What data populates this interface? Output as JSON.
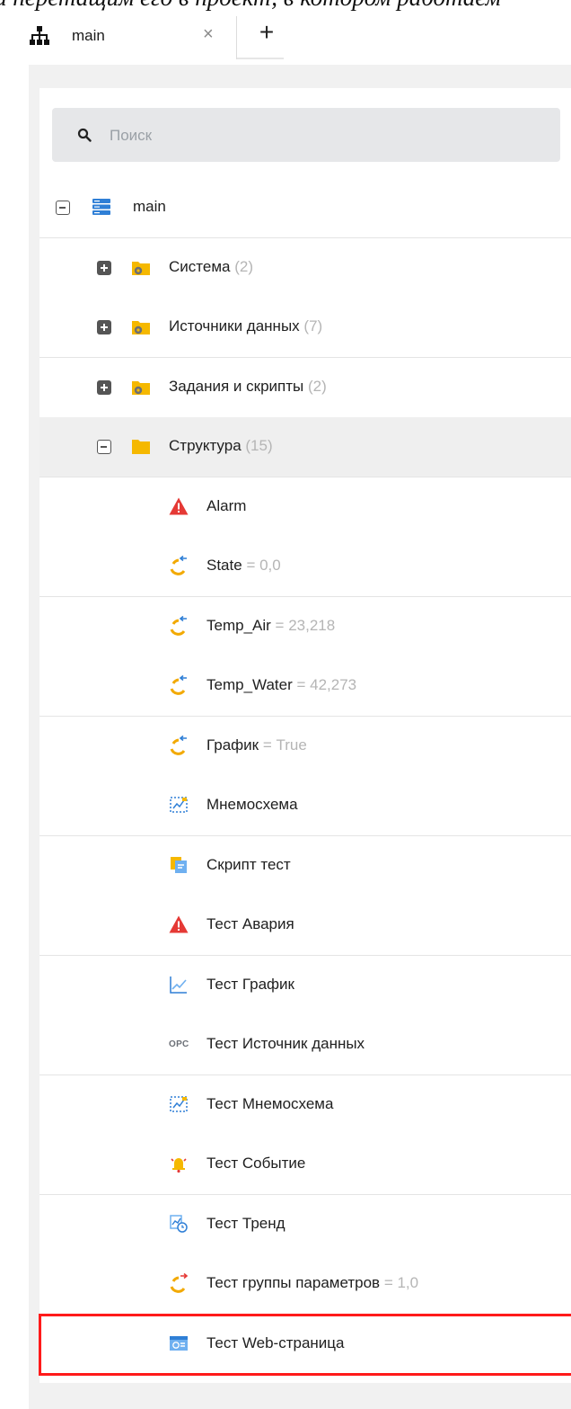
{
  "cutoff_text": "и перетащим его в проект, в котором работаем",
  "tab": {
    "title": "main",
    "close": "×",
    "add": "+"
  },
  "search": {
    "placeholder": "Поиск",
    "value": ""
  },
  "tree": {
    "root": {
      "label": "main"
    },
    "folders": [
      {
        "label": "Система",
        "count": "(2)"
      },
      {
        "label": "Источники данных",
        "count": "(7)"
      },
      {
        "label": "Задания и скрипты",
        "count": "(2)"
      },
      {
        "label": "Структура",
        "count": "(15)"
      }
    ],
    "items": [
      {
        "label": "Alarm",
        "value": "",
        "icon": "alarm-icon"
      },
      {
        "label": "State",
        "value": "= 0,0",
        "icon": "parameter-icon"
      },
      {
        "label": "Temp_Air",
        "value": "= 23,218",
        "icon": "parameter-icon"
      },
      {
        "label": "Temp_Water",
        "value": "= 42,273",
        "icon": "parameter-icon"
      },
      {
        "label": "График",
        "value": "= True",
        "icon": "parameter-icon"
      },
      {
        "label": "Мнемосхема",
        "value": "",
        "icon": "mnemoscheme-icon"
      },
      {
        "label": "Скрипт тест",
        "value": "",
        "icon": "script-icon"
      },
      {
        "label": "Тест Авария",
        "value": "",
        "icon": "alarm-icon"
      },
      {
        "label": "Тест График",
        "value": "",
        "icon": "chart-icon"
      },
      {
        "label": "Тест Источник данных",
        "value": "",
        "icon": "opc-icon",
        "icon_text": "OPC"
      },
      {
        "label": "Тест Мнемосхема",
        "value": "",
        "icon": "mnemoscheme-icon"
      },
      {
        "label": "Тест Событие",
        "value": "",
        "icon": "event-bell-icon"
      },
      {
        "label": "Тест Тренд",
        "value": "",
        "icon": "trend-icon"
      },
      {
        "label": "Тест группы параметров",
        "value": "= 1,0",
        "icon": "parameter-group-icon"
      },
      {
        "label": "Тест Web-страница",
        "value": "",
        "icon": "web-page-icon"
      }
    ]
  },
  "colors": {
    "highlight": "#ff1a1a",
    "folder": "#f5b800",
    "alarm": "#e53935",
    "value_gray": "#b5b5b5"
  }
}
